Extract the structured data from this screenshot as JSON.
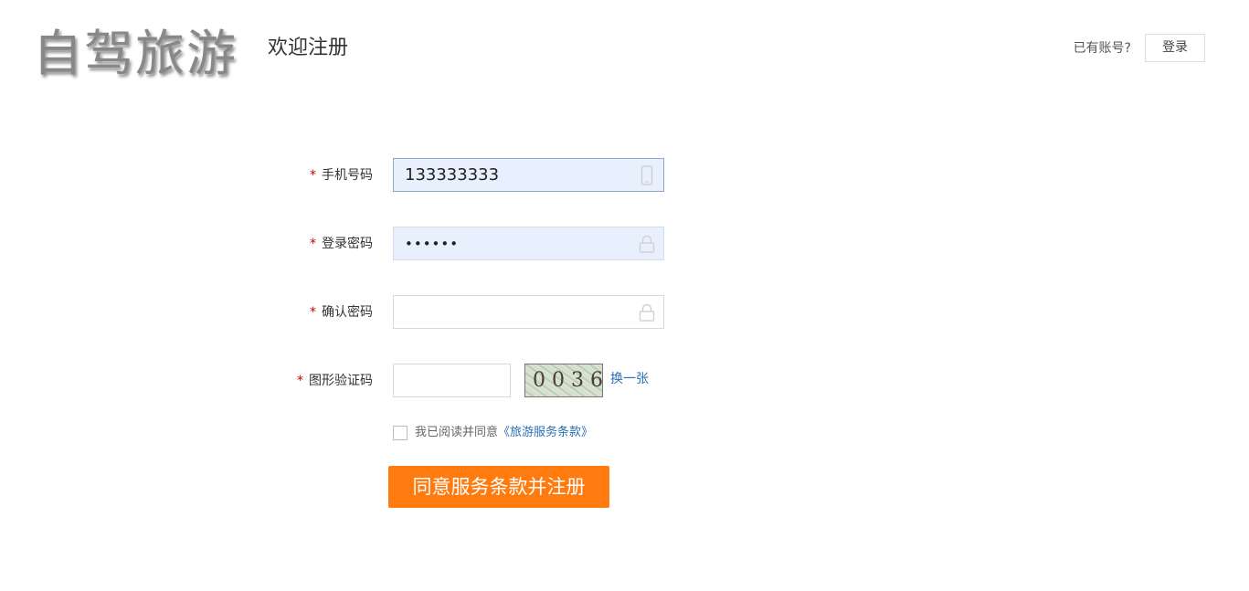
{
  "header": {
    "logo_text": "自驾旅游",
    "welcome": "欢迎注册",
    "have_account": "已有账号?",
    "login_label": "登录"
  },
  "form": {
    "phone": {
      "label": "手机号码",
      "value": "133333333",
      "icon": "phone-icon"
    },
    "password": {
      "label": "登录密码",
      "value": "••••••",
      "icon": "lock-icon"
    },
    "confirm_password": {
      "label": "确认密码",
      "value": "",
      "icon": "lock-icon"
    },
    "captcha": {
      "label": "图形验证码",
      "value": "",
      "image_text": "0036",
      "refresh_label": "换一张"
    },
    "required_mark": "*",
    "agree": {
      "checked": false,
      "text": "我已阅读并同意",
      "terms_link": "《旅游服务条款》"
    },
    "submit_label": "同意服务条款并注册"
  },
  "colors": {
    "accent": "#ff7b0f",
    "link": "#2a6fb0",
    "required": "#cc0000",
    "filled_input_bg": "#e8f0fe"
  }
}
